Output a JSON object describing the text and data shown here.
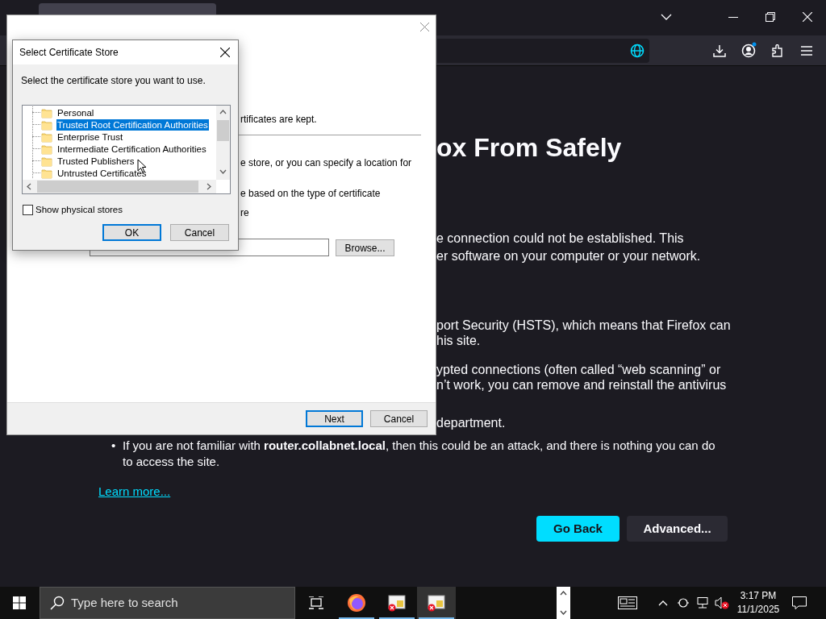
{
  "error_page": {
    "heading": "ox From Safely",
    "bullet_mark": "•",
    "lines": [
      "e connection could not be established. This",
      "er software on your computer or your network.",
      "port Security (HSTS), which means that Firefox can",
      "his site.",
      "ypted connections (often called “web scanning” or",
      "n’t work, you can remove and reinstall the antivirus",
      "department."
    ],
    "bullet": "If you are not familiar with **router.collabnet.local**, then this could be an attack, and there is nothing you can do to access the site.",
    "learn_more": "Learn more...",
    "buttons": [
      {
        "label": "Go Back",
        "kind": "primary"
      },
      {
        "label": "Advanced...",
        "kind": "secondary"
      }
    ]
  },
  "import_wizard": {
    "fragments": [
      "rtificates are kept.",
      "e store, or you can specify a location for",
      "e based on the type of certificate",
      "re"
    ],
    "browse_button": "Browse...",
    "buttons": [
      {
        "label": "Next",
        "focused": true
      },
      {
        "label": "Cancel",
        "focused": false
      }
    ]
  },
  "store_dialog": {
    "title": "Select Certificate Store",
    "instruction": "Select the certificate store you want to use.",
    "stores": [
      {
        "label": "Personal",
        "selected": false
      },
      {
        "label": "Trusted Root Certification Authorities",
        "selected": true
      },
      {
        "label": "Enterprise Trust",
        "selected": false
      },
      {
        "label": "Intermediate Certification Authorities",
        "selected": false
      },
      {
        "label": "Trusted Publishers",
        "selected": false
      },
      {
        "label": "Untrusted Certificates",
        "selected": false
      }
    ],
    "show_physical_stores": {
      "label": "Show physical stores",
      "checked": false
    },
    "buttons": [
      {
        "label": "OK",
        "focused": true
      },
      {
        "label": "Cancel",
        "focused": false
      }
    ]
  },
  "taskbar": {
    "search_placeholder": "Type here to search",
    "time": "3:17 PM",
    "date": "11/1/2025"
  }
}
